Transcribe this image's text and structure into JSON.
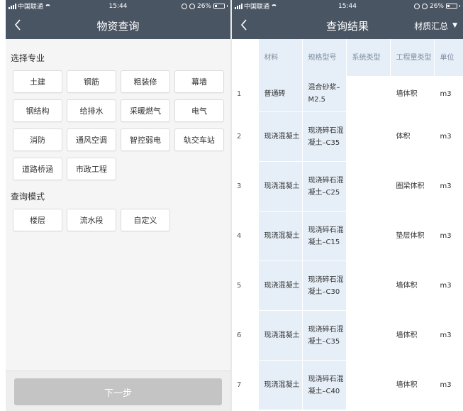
{
  "status_bar": {
    "carrier": "中国联通",
    "time": "15:44",
    "battery": "26%",
    "battery_level": 0.26
  },
  "left": {
    "title": "物资查询",
    "major_section": "选择专业",
    "majors": [
      "土建",
      "钢筋",
      "粗装修",
      "幕墙",
      "钢结构",
      "给排水",
      "采暖燃气",
      "电气",
      "消防",
      "通风空调",
      "智控弱电",
      "轨交车站",
      "道路桥涵",
      "市政工程"
    ],
    "mode_section": "查询模式",
    "modes": [
      "楼层",
      "流水段",
      "自定义"
    ],
    "next_label": "下一步"
  },
  "right": {
    "title": "查询结果",
    "summary_label": "材质汇总",
    "table": {
      "headers": [
        "材料",
        "规格型号",
        "系统类型",
        "工程量类型",
        "单位"
      ],
      "rows": [
        {
          "index": "1",
          "material": "普通砖",
          "spec": "混合砂浆–M2.5",
          "system": "",
          "qty_type": "墙体积",
          "unit": "m3"
        },
        {
          "index": "2",
          "material": "现浇混凝土",
          "spec": "现浇碎石混凝土–C35",
          "system": "",
          "qty_type": "体积",
          "unit": "m3"
        },
        {
          "index": "3",
          "material": "现浇混凝土",
          "spec": "现浇碎石混凝土–C25",
          "system": "",
          "qty_type": "圈梁体积",
          "unit": "m3"
        },
        {
          "index": "4",
          "material": "现浇混凝土",
          "spec": "现浇碎石混凝土–C15",
          "system": "",
          "qty_type": "垫层体积",
          "unit": "m3"
        },
        {
          "index": "5",
          "material": "现浇混凝土",
          "spec": "现浇碎石混凝土–C30",
          "system": "",
          "qty_type": "墙体积",
          "unit": "m3"
        },
        {
          "index": "6",
          "material": "现浇混凝土",
          "spec": "现浇碎石混凝土–C35",
          "system": "",
          "qty_type": "墙体积",
          "unit": "m3"
        },
        {
          "index": "7",
          "material": "现浇混凝土",
          "spec": "现浇碎石混凝土–C40",
          "system": "",
          "qty_type": "墙体积",
          "unit": "m3"
        }
      ]
    }
  }
}
